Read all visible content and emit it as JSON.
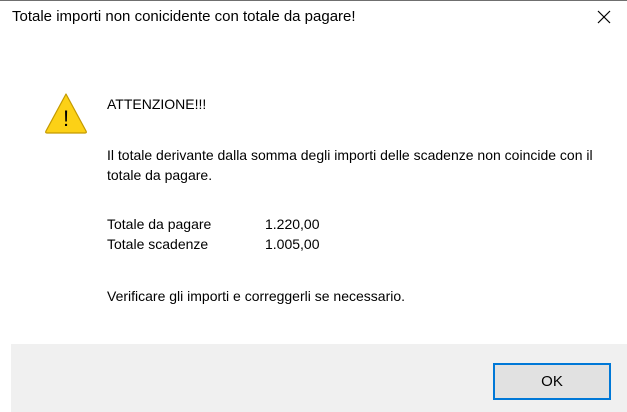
{
  "window": {
    "title": "Totale importi non conicidente con totale da pagare!",
    "close_icon": "close-icon"
  },
  "icon": {
    "name": "warning-icon",
    "fill": "#fcd116",
    "stroke": "#c49a00",
    "glyph": "!"
  },
  "message": {
    "heading": "ATTENZIONE!!!",
    "body": "Il totale derivante dalla somma degli importi delle scadenze non coincide con il totale da pagare.",
    "rows": [
      {
        "label": "Totale da pagare",
        "value": "1.220,00"
      },
      {
        "label": "Totale scadenze",
        "value": "1.005,00"
      }
    ],
    "footer_note": "Verificare gli importi e correggerli se necessario."
  },
  "buttons": {
    "ok_label": "OK"
  },
  "colors": {
    "accent": "#0078d7",
    "footer_bg": "#f0f0f0",
    "button_bg": "#e1e1e1"
  }
}
